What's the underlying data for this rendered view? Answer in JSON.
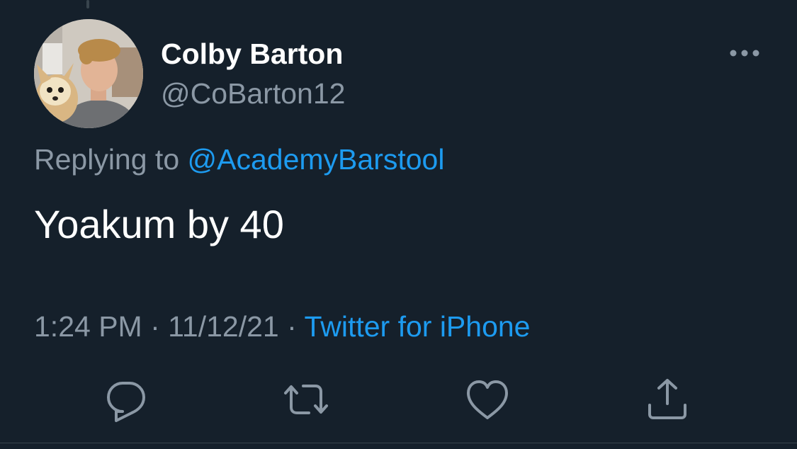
{
  "tweet": {
    "author": {
      "name": "Colby Barton",
      "handle": "@CoBarton12",
      "avatar_icon": "profile-photo"
    },
    "reply_context": {
      "prefix": "Replying to",
      "mention": "@AcademyBarstool"
    },
    "text": "Yoakum by 40",
    "meta": {
      "time": "1:24 PM",
      "separator": "·",
      "date": "11/12/21",
      "source": "Twitter for iPhone"
    },
    "actions": [
      {
        "icon": "reply-icon"
      },
      {
        "icon": "retweet-icon"
      },
      {
        "icon": "like-icon"
      },
      {
        "icon": "share-icon"
      }
    ],
    "more_icon": "more-horizontal-icon"
  },
  "colors": {
    "background": "#15202b",
    "text_primary": "#ffffff",
    "text_secondary": "#8b98a5",
    "accent": "#1d9bf0",
    "border": "#38444d"
  }
}
